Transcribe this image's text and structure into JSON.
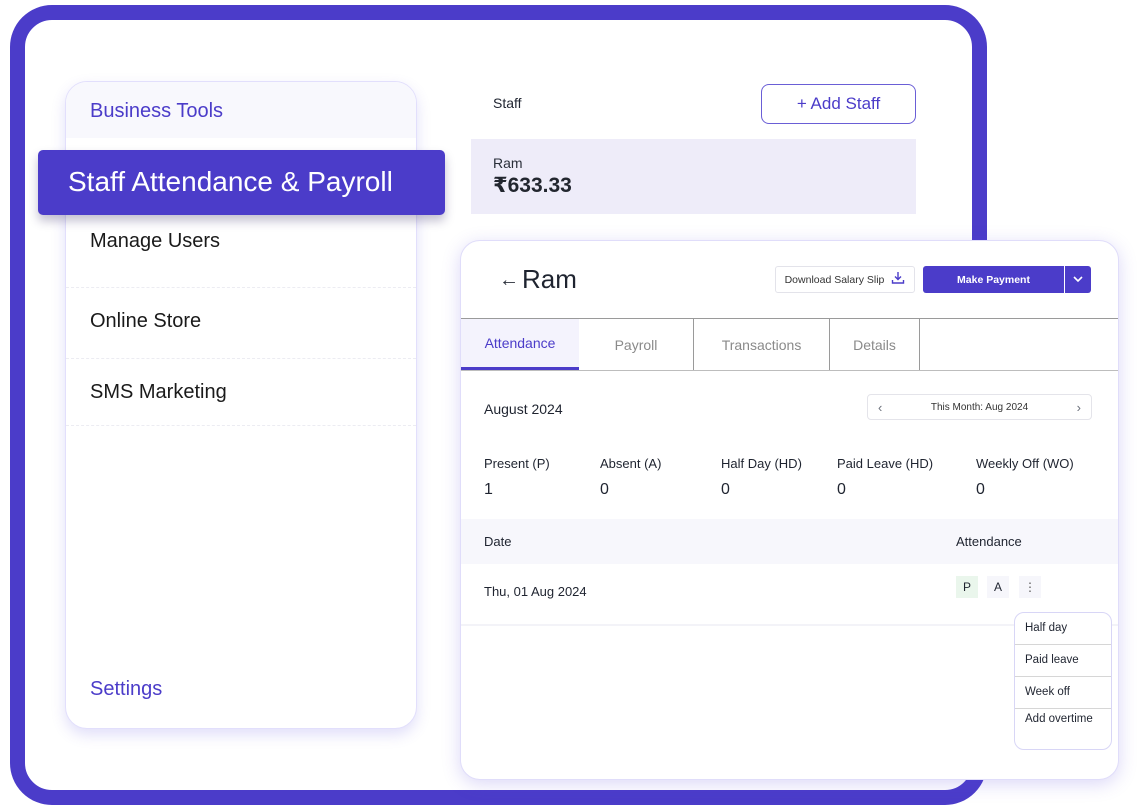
{
  "colors": {
    "brand": "#4b3cc9",
    "card_bg": "#eeecf9",
    "present_bg": "#eaf6ec"
  },
  "sidebar": {
    "header": "Business Tools",
    "highlighted": "Staff Attendance & Payroll",
    "items": [
      {
        "label": "Manage Users"
      },
      {
        "label": "Online Store"
      },
      {
        "label": "SMS Marketing"
      }
    ],
    "footer": "Settings"
  },
  "staff_list": {
    "title": "Staff",
    "add_button": {
      "icon": "plus-icon",
      "label": "+ Add Staff"
    },
    "items": [
      {
        "name": "Ram",
        "amount": "₹633.33"
      }
    ]
  },
  "detail": {
    "back_icon": "arrow-left-icon",
    "title": "Ram",
    "download_button": {
      "label": "Download Salary Slip",
      "icon": "download-icon"
    },
    "pay_button": {
      "label": "Make Payment",
      "icon": "chevron-down-icon"
    },
    "tabs": [
      {
        "label": "Attendance",
        "active": true
      },
      {
        "label": "Payroll",
        "active": false
      },
      {
        "label": "Transactions",
        "active": false
      },
      {
        "label": "Details",
        "active": false
      }
    ],
    "month_label": "August 2024",
    "month_picker": {
      "label": "This Month:  Aug 2024",
      "prev": "‹",
      "next": "›"
    },
    "stats": [
      {
        "label": "Present (P)",
        "value": "1"
      },
      {
        "label": "Absent (A)",
        "value": "0"
      },
      {
        "label": "Half Day (HD)",
        "value": "0"
      },
      {
        "label": "Paid Leave (HD)",
        "value": "0"
      },
      {
        "label": "Weekly Off (WO)",
        "value": "0"
      }
    ],
    "table": {
      "headers": [
        "Date",
        "Attendance"
      ],
      "rows": [
        {
          "date": "Thu, 01 Aug 2024",
          "present": "P",
          "absent": "A",
          "more": "⋮"
        }
      ]
    },
    "more_menu": [
      {
        "label": "Half day"
      },
      {
        "label": "Paid leave"
      },
      {
        "label": "Week off"
      },
      {
        "label": "Add overtime"
      }
    ]
  }
}
